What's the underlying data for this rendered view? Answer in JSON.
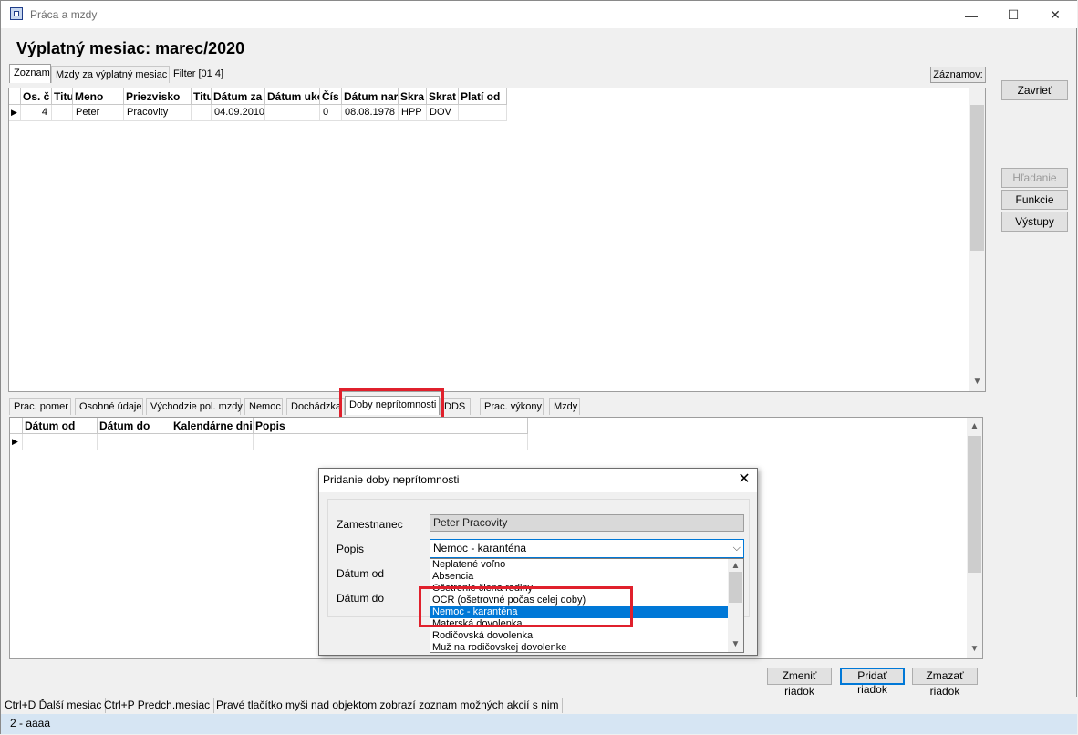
{
  "window": {
    "title": "Práca a mzdy",
    "minimize_glyph": "—",
    "maximize_glyph": "☐",
    "close_glyph": "✕"
  },
  "heading": "Výplatný mesiac: marec/2020",
  "top_tabs": [
    "Zoznam",
    "Mzdy za výplatný mesiac",
    "Filter [01 4]"
  ],
  "records_label": "Záznamov:",
  "main_grid": {
    "columns": [
      "Os. č",
      "Titu",
      "Meno",
      "Priezvisko",
      "Titu",
      "Dátum za",
      "Dátum uko",
      "Čís",
      "Dátum nar",
      "Skra",
      "Skrat",
      "Platí od"
    ],
    "rows": [
      [
        "4",
        "",
        "Peter",
        "Pracovity",
        "",
        "04.09.2010",
        "",
        "0",
        "08.08.1978",
        "HPP",
        "DOV",
        ""
      ]
    ]
  },
  "side_buttons": {
    "close": "Zavrieť",
    "search": "Hľadanie",
    "functions": "Funkcie",
    "outputs": "Výstupy"
  },
  "detail_tabs": [
    "Prac. pomer",
    "Osobné údaje",
    "Východzie pol. mzdy",
    "Nemoc",
    "Dochádzka",
    "Doby neprítomnosti",
    "DDS",
    "Prac. výkony",
    "Mzdy"
  ],
  "detail_grid": {
    "columns": [
      "Dátum od",
      "Dátum do",
      "Kalendárne dni",
      "Popis"
    ]
  },
  "bottom_buttons": {
    "change": "Zmeniť riadok",
    "add": "Pridať riadok",
    "delete": "Zmazať riadok"
  },
  "statusbar": [
    "Ctrl+D Ďalší mesiac",
    "Ctrl+P Predch.mesiac",
    "Pravé tlačítko myši nad objektom zobrazí zoznam možných akcií s nim"
  ],
  "infobar": "2 - aaaa",
  "dialog": {
    "title": "Pridanie doby neprítomnosti",
    "labels": {
      "employee": "Zamestnanec",
      "description": "Popis",
      "date_from": "Dátum od",
      "date_to": "Dátum do"
    },
    "employee_value": "Peter Pracovity",
    "description_value": "Nemoc - karanténa",
    "options": [
      "Neplatené voľno",
      "Absencia",
      "Ošetrenie člena rodiny",
      "OČR (ošetrovné počas celej doby)",
      "Nemoc - karanténa",
      "Materská dovolenka",
      "Rodičovská dovolenka",
      "Muž na rodičovskej dovolenke"
    ],
    "selected_index": 4
  },
  "colors": {
    "accent": "#0078d7",
    "highlight_box": "#e0202c",
    "infobar": "#d6e5f3"
  }
}
